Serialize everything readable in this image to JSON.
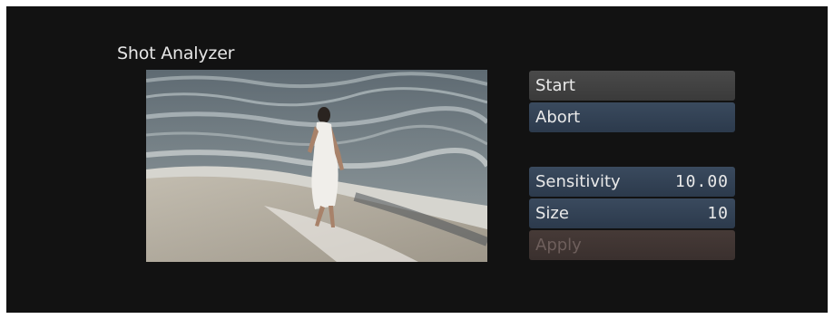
{
  "panel": {
    "title": "Shot Analyzer"
  },
  "preview": {
    "icon": "beach-video-frame"
  },
  "controls": {
    "start_label": "Start",
    "abort_label": "Abort",
    "sensitivity_label": "Sensitivity",
    "sensitivity_value": "10.00",
    "size_label": "Size",
    "size_value": "10",
    "apply_label": "Apply"
  },
  "colors": {
    "background": "#121212",
    "button_grey": "#444444",
    "field_blue": "#34445a",
    "apply_disabled": "#423634"
  }
}
